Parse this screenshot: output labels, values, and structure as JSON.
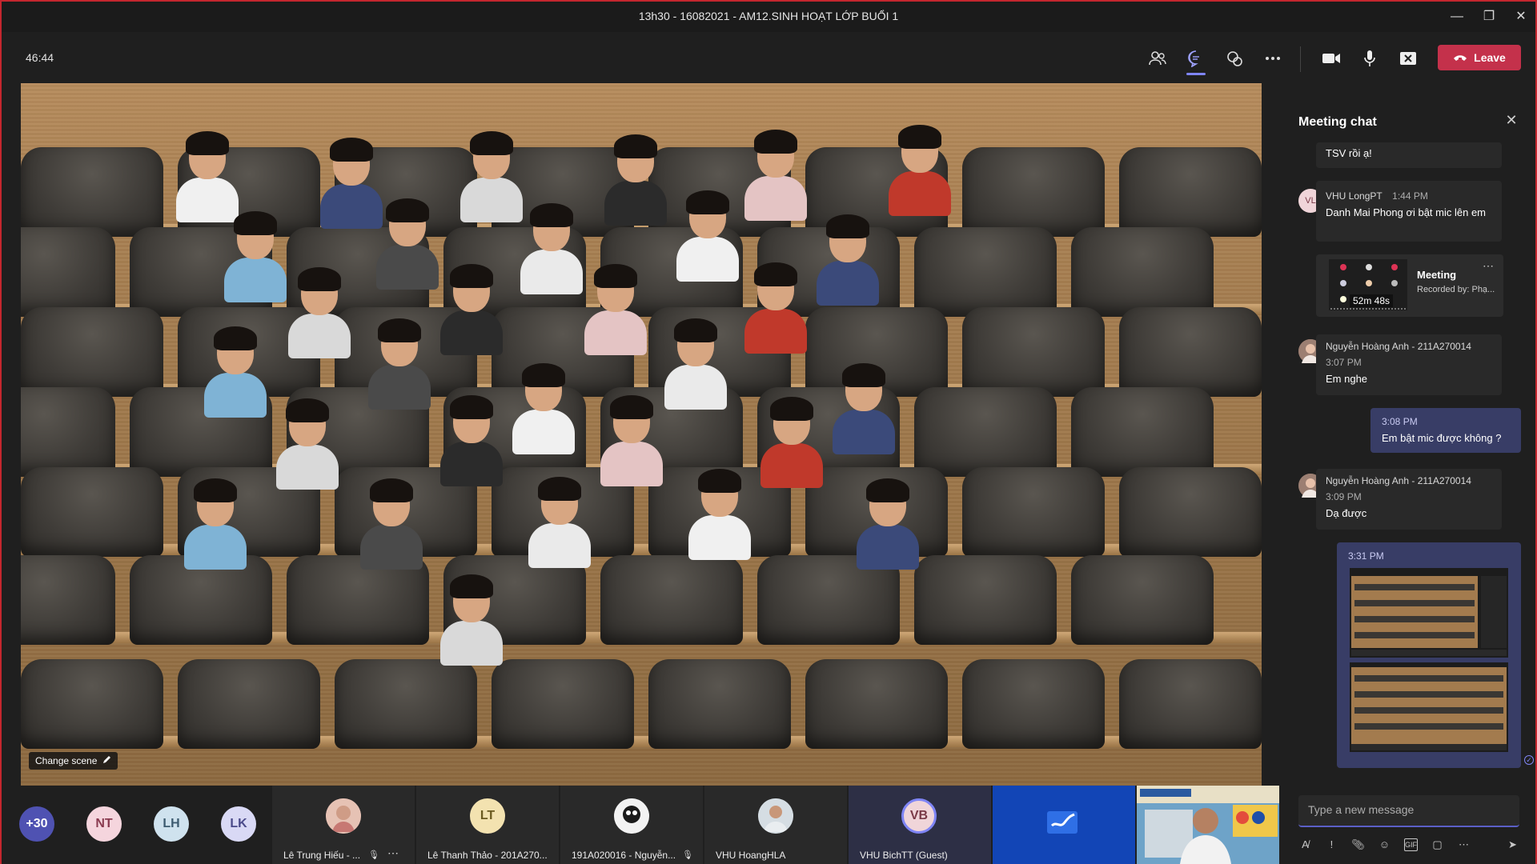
{
  "window": {
    "title": "13h30 - 16082021 - AM12.SINH HOẠT LỚP BUỔI 1",
    "minimize_icon": "minimize-icon",
    "maximize_icon": "restore-icon",
    "close_icon": "close-icon"
  },
  "toolbar": {
    "timer": "46:44",
    "leave_label": "Leave",
    "icons": [
      "people-icon",
      "chat-icon",
      "reactions-icon",
      "more-icon",
      "camera-icon",
      "microphone-icon",
      "share-tray-icon"
    ]
  },
  "stage": {
    "change_scene_label": "Change scene"
  },
  "participants": {
    "overflow_count": "+30",
    "avatars": [
      {
        "initials": "NT",
        "color": "#f5d5dd"
      },
      {
        "initials": "LH",
        "color": "#cfe2ee"
      },
      {
        "initials": "LK",
        "color": "#d9d9f5"
      }
    ],
    "tiles": [
      {
        "name": "Lê Trung Hiếu - ...",
        "muted": true,
        "kind": "photo"
      },
      {
        "name": "Lê Thanh Thảo - 201A270...",
        "initials": "LT",
        "muted": false,
        "kind": "initials"
      },
      {
        "name": "191A020016 - Nguyễn...",
        "muted": true,
        "kind": "photo"
      },
      {
        "name": "VHU HoangHLA",
        "muted": false,
        "kind": "photo"
      },
      {
        "name": "VHU BichTT (Guest)",
        "initials": "VB",
        "muted": false,
        "kind": "initials"
      },
      {
        "name": "",
        "muted": false,
        "kind": "whiteboard"
      },
      {
        "name": "",
        "muted": false,
        "kind": "video"
      }
    ]
  },
  "chat": {
    "title": "Meeting chat",
    "messages": [
      {
        "text": "TSV rồi ạ!"
      },
      {
        "initials": "VL",
        "author": "VHU LongPT",
        "time": "1:44 PM",
        "text": "Danh Mai Phong ơi bật mic lên em"
      },
      {
        "card_title": "Meeting",
        "card_sub": "Recorded by: Phạ...",
        "duration": "52m 48s"
      },
      {
        "author": "Nguyễn Hoàng Anh - 211A270014",
        "time": "3:07 PM",
        "text": "Em nghe"
      },
      {
        "time": "3:08 PM",
        "text": "Em bật mic được không ?"
      },
      {
        "author": "Nguyễn Hoàng Anh - 211A270014",
        "time": "3:09 PM",
        "text": "Dạ được"
      },
      {
        "time": "3:31 PM"
      }
    ],
    "composer_placeholder": "Type a new message"
  },
  "colors": {
    "leave": "#c4314b",
    "accent": "#7f85f5",
    "my_message": "#383d66"
  }
}
